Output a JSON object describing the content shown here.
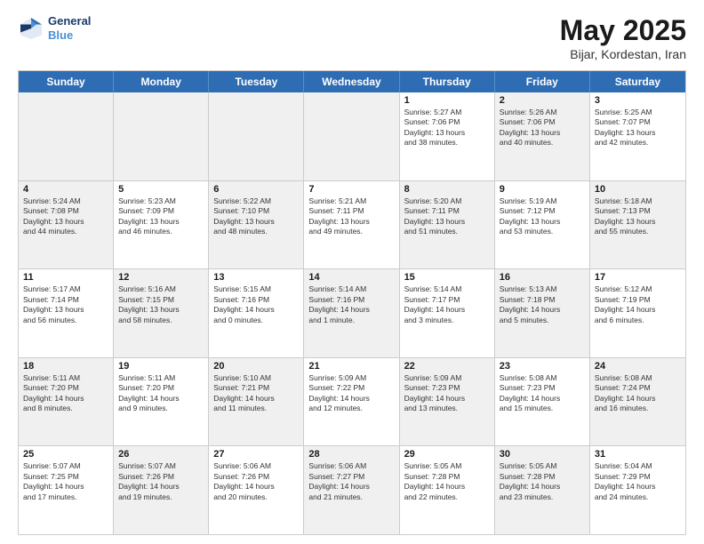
{
  "header": {
    "logo_line1": "General",
    "logo_line2": "Blue",
    "title": "May 2025",
    "subtitle": "Bijar, Kordestan, Iran"
  },
  "weekdays": [
    "Sunday",
    "Monday",
    "Tuesday",
    "Wednesday",
    "Thursday",
    "Friday",
    "Saturday"
  ],
  "rows": [
    [
      {
        "day": "",
        "info": "",
        "shaded": true
      },
      {
        "day": "",
        "info": "",
        "shaded": true
      },
      {
        "day": "",
        "info": "",
        "shaded": true
      },
      {
        "day": "",
        "info": "",
        "shaded": true
      },
      {
        "day": "1",
        "info": "Sunrise: 5:27 AM\nSunset: 7:06 PM\nDaylight: 13 hours\nand 38 minutes."
      },
      {
        "day": "2",
        "info": "Sunrise: 5:26 AM\nSunset: 7:06 PM\nDaylight: 13 hours\nand 40 minutes.",
        "shaded": true
      },
      {
        "day": "3",
        "info": "Sunrise: 5:25 AM\nSunset: 7:07 PM\nDaylight: 13 hours\nand 42 minutes."
      }
    ],
    [
      {
        "day": "4",
        "info": "Sunrise: 5:24 AM\nSunset: 7:08 PM\nDaylight: 13 hours\nand 44 minutes.",
        "shaded": true
      },
      {
        "day": "5",
        "info": "Sunrise: 5:23 AM\nSunset: 7:09 PM\nDaylight: 13 hours\nand 46 minutes."
      },
      {
        "day": "6",
        "info": "Sunrise: 5:22 AM\nSunset: 7:10 PM\nDaylight: 13 hours\nand 48 minutes.",
        "shaded": true
      },
      {
        "day": "7",
        "info": "Sunrise: 5:21 AM\nSunset: 7:11 PM\nDaylight: 13 hours\nand 49 minutes."
      },
      {
        "day": "8",
        "info": "Sunrise: 5:20 AM\nSunset: 7:11 PM\nDaylight: 13 hours\nand 51 minutes.",
        "shaded": true
      },
      {
        "day": "9",
        "info": "Sunrise: 5:19 AM\nSunset: 7:12 PM\nDaylight: 13 hours\nand 53 minutes."
      },
      {
        "day": "10",
        "info": "Sunrise: 5:18 AM\nSunset: 7:13 PM\nDaylight: 13 hours\nand 55 minutes.",
        "shaded": true
      }
    ],
    [
      {
        "day": "11",
        "info": "Sunrise: 5:17 AM\nSunset: 7:14 PM\nDaylight: 13 hours\nand 56 minutes."
      },
      {
        "day": "12",
        "info": "Sunrise: 5:16 AM\nSunset: 7:15 PM\nDaylight: 13 hours\nand 58 minutes.",
        "shaded": true
      },
      {
        "day": "13",
        "info": "Sunrise: 5:15 AM\nSunset: 7:16 PM\nDaylight: 14 hours\nand 0 minutes."
      },
      {
        "day": "14",
        "info": "Sunrise: 5:14 AM\nSunset: 7:16 PM\nDaylight: 14 hours\nand 1 minute.",
        "shaded": true
      },
      {
        "day": "15",
        "info": "Sunrise: 5:14 AM\nSunset: 7:17 PM\nDaylight: 14 hours\nand 3 minutes."
      },
      {
        "day": "16",
        "info": "Sunrise: 5:13 AM\nSunset: 7:18 PM\nDaylight: 14 hours\nand 5 minutes.",
        "shaded": true
      },
      {
        "day": "17",
        "info": "Sunrise: 5:12 AM\nSunset: 7:19 PM\nDaylight: 14 hours\nand 6 minutes."
      }
    ],
    [
      {
        "day": "18",
        "info": "Sunrise: 5:11 AM\nSunset: 7:20 PM\nDaylight: 14 hours\nand 8 minutes.",
        "shaded": true
      },
      {
        "day": "19",
        "info": "Sunrise: 5:11 AM\nSunset: 7:20 PM\nDaylight: 14 hours\nand 9 minutes."
      },
      {
        "day": "20",
        "info": "Sunrise: 5:10 AM\nSunset: 7:21 PM\nDaylight: 14 hours\nand 11 minutes.",
        "shaded": true
      },
      {
        "day": "21",
        "info": "Sunrise: 5:09 AM\nSunset: 7:22 PM\nDaylight: 14 hours\nand 12 minutes."
      },
      {
        "day": "22",
        "info": "Sunrise: 5:09 AM\nSunset: 7:23 PM\nDaylight: 14 hours\nand 13 minutes.",
        "shaded": true
      },
      {
        "day": "23",
        "info": "Sunrise: 5:08 AM\nSunset: 7:23 PM\nDaylight: 14 hours\nand 15 minutes."
      },
      {
        "day": "24",
        "info": "Sunrise: 5:08 AM\nSunset: 7:24 PM\nDaylight: 14 hours\nand 16 minutes.",
        "shaded": true
      }
    ],
    [
      {
        "day": "25",
        "info": "Sunrise: 5:07 AM\nSunset: 7:25 PM\nDaylight: 14 hours\nand 17 minutes."
      },
      {
        "day": "26",
        "info": "Sunrise: 5:07 AM\nSunset: 7:26 PM\nDaylight: 14 hours\nand 19 minutes.",
        "shaded": true
      },
      {
        "day": "27",
        "info": "Sunrise: 5:06 AM\nSunset: 7:26 PM\nDaylight: 14 hours\nand 20 minutes."
      },
      {
        "day": "28",
        "info": "Sunrise: 5:06 AM\nSunset: 7:27 PM\nDaylight: 14 hours\nand 21 minutes.",
        "shaded": true
      },
      {
        "day": "29",
        "info": "Sunrise: 5:05 AM\nSunset: 7:28 PM\nDaylight: 14 hours\nand 22 minutes."
      },
      {
        "day": "30",
        "info": "Sunrise: 5:05 AM\nSunset: 7:28 PM\nDaylight: 14 hours\nand 23 minutes.",
        "shaded": true
      },
      {
        "day": "31",
        "info": "Sunrise: 5:04 AM\nSunset: 7:29 PM\nDaylight: 14 hours\nand 24 minutes."
      }
    ]
  ]
}
